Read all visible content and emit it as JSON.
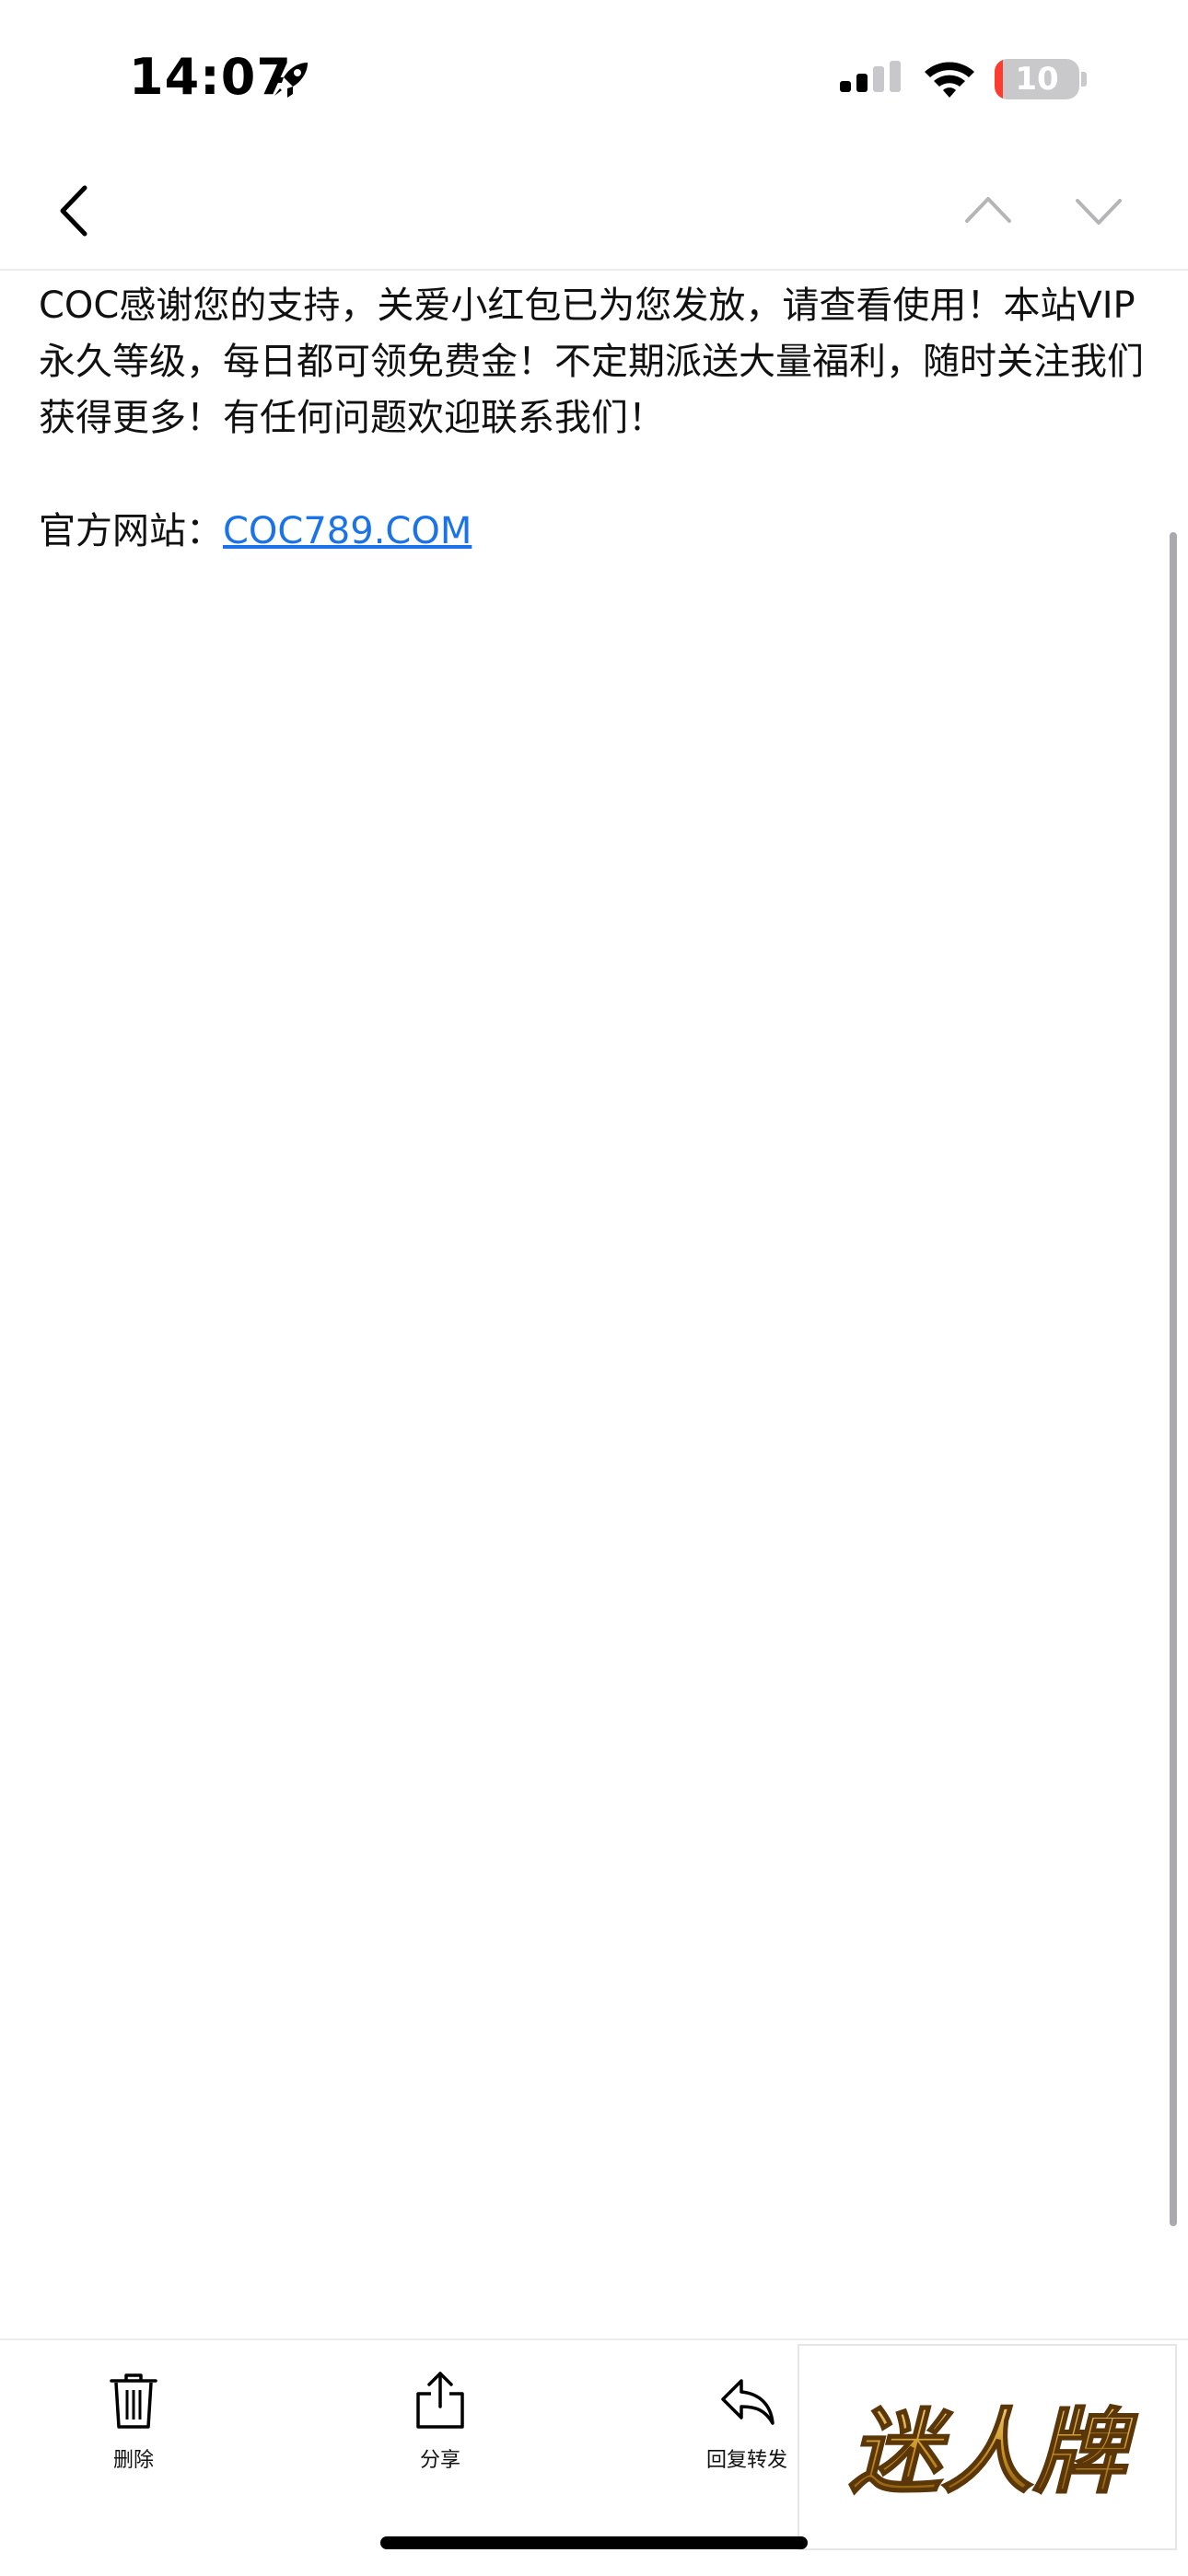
{
  "status_bar": {
    "time": "14:07",
    "battery": "10",
    "battery_level": 0.1,
    "icons": [
      "rocket-icon",
      "cellular-signal-icon",
      "wifi-icon",
      "battery-charging-icon"
    ]
  },
  "nav": {
    "icons": [
      "chevron-left-icon",
      "chevron-up-icon",
      "chevron-down-icon"
    ]
  },
  "message": {
    "body": "COC感谢您的支持，关爱小红包已为您发放，请查看使用！本站VIP永久等级，每日都可领免费金！不定期派送大量福利，随时关注我们获得更多！有任何问题欢迎联系我们！",
    "site_label": "官方网站：",
    "site_link": "COC789.COM"
  },
  "toolbar": {
    "delete_label": "删除",
    "share_label": "分享",
    "reply_label": "回复转发"
  },
  "ad": {
    "text": "迷人牌"
  },
  "colors": {
    "link": "#1a73e8",
    "battery_low": "#ff3b30",
    "gold": "#c8921e"
  }
}
